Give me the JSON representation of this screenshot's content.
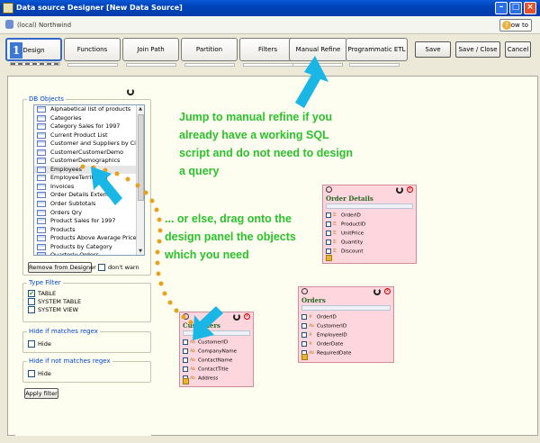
{
  "window": {
    "title": "Data source Designer [New Data Source]"
  },
  "connection": {
    "label": "(local) Northwind"
  },
  "howto": {
    "label": "How to"
  },
  "tabs": [
    {
      "label": "Design",
      "active": true
    },
    {
      "label": "Functions"
    },
    {
      "label": "Join Path"
    },
    {
      "label": "Partition"
    },
    {
      "label": "Filters"
    },
    {
      "label": "Manual Refine"
    },
    {
      "label": "Programmatic ETL"
    }
  ],
  "tab_badge": "1",
  "actions": {
    "save": "Save",
    "save_close": "Save / Close",
    "cancel": "Cancel"
  },
  "db_objects": {
    "legend": "DB Objects",
    "items": [
      "Alphabetical list of products",
      "Categories",
      "Category Sales for 1997",
      "Current Product List",
      "Customer and Suppliers by City",
      "CustomerCustomerDemo",
      "CustomerDemographics",
      "Employees",
      "EmployeeTerritories",
      "Invoices",
      "Order Details Extended",
      "Order Subtotals",
      "Orders Qry",
      "Product Sales for 1997",
      "Products",
      "Products Above Average Price",
      "Products by Category",
      "Quarterly Orders"
    ],
    "selected": "Employees",
    "remove_button": "Remove from Designer",
    "dont_warn": "don't warn"
  },
  "type_filter": {
    "legend": "Type Filter",
    "options": [
      {
        "label": "TABLE",
        "checked": true
      },
      {
        "label": "SYSTEM TABLE",
        "checked": false
      },
      {
        "label": "SYSTEM VIEW",
        "checked": false
      }
    ]
  },
  "hide_matches": {
    "legend": "Hide if matches regex",
    "label": "Hide"
  },
  "hide_not_matches": {
    "legend": "Hide if not matches regex",
    "label": "Hide"
  },
  "apply_filter": "Apply filter",
  "annotations": {
    "manual_refine": [
      "Jump to manual refine if you",
      "already have a working SQL",
      "script and do not need to design",
      "a query"
    ],
    "drag": [
      "... or else, drag onto the",
      "design panel the objects",
      "which you need"
    ]
  },
  "tables": [
    {
      "name": "Order Details",
      "columns": [
        {
          "name": "OrderID",
          "type": "key"
        },
        {
          "name": "ProductID",
          "type": "key"
        },
        {
          "name": "UnitPrice",
          "type": "key"
        },
        {
          "name": "Quantity",
          "type": "key"
        },
        {
          "name": "Discount",
          "type": "key"
        }
      ]
    },
    {
      "name": "Orders",
      "columns": [
        {
          "name": "OrderID",
          "type": "num"
        },
        {
          "name": "CustomerID",
          "type": "text"
        },
        {
          "name": "EmployeeID",
          "type": "num"
        },
        {
          "name": "OrderDate",
          "type": "num"
        },
        {
          "name": "RequiredDate",
          "type": "text"
        }
      ]
    },
    {
      "name": "Customers",
      "columns": [
        {
          "name": "CustomerID",
          "type": "text"
        },
        {
          "name": "CompanyName",
          "type": "text"
        },
        {
          "name": "ContactName",
          "type": "text"
        },
        {
          "name": "ContactTitle",
          "type": "text"
        },
        {
          "name": "Address",
          "type": "text"
        }
      ]
    }
  ],
  "colors": {
    "accent": "#2dc12d",
    "arrow": "#19b6e6",
    "dots": "#e8a11c",
    "panel_bg": "#fdfdf0",
    "table_bg": "#fdd6de"
  }
}
